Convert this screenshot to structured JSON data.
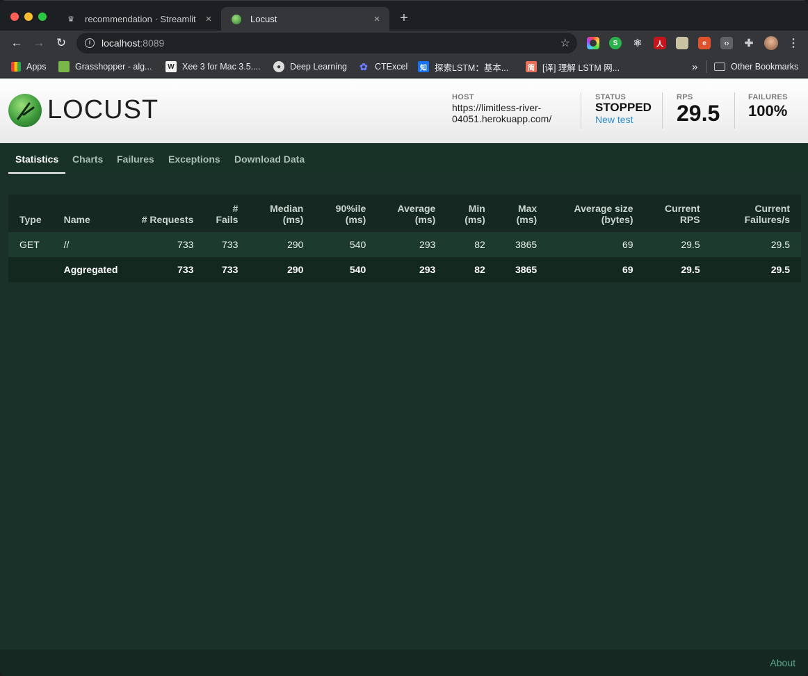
{
  "browser": {
    "tabs": [
      {
        "title": "recommendation · Streamlit",
        "favicon": "crown-icon"
      },
      {
        "title": "Locust",
        "favicon": "locust-icon"
      }
    ],
    "url_host": "localhost",
    "url_port": ":8089",
    "bookmarks": [
      {
        "label": "Apps",
        "icon": "apps-grid-icon"
      },
      {
        "label": "Grasshopper - alg...",
        "icon": "grasshopper-icon"
      },
      {
        "label": "Xee 3 for Mac 3.5....",
        "icon": "xee-icon"
      },
      {
        "label": "Deep Learning",
        "icon": "globe-icon"
      },
      {
        "label": "CTExcel",
        "icon": "ctexcel-icon"
      },
      {
        "label": "探索LSTM：基本...",
        "icon": "zhihu-icon"
      },
      {
        "label": "[译] 理解 LSTM 网...",
        "icon": "jianshu-icon"
      }
    ],
    "bookmarks_overflow": "»",
    "other_bookmarks": "Other Bookmarks"
  },
  "header": {
    "logo_text": "LOCUST",
    "host_label": "HOST",
    "host_value": "https://limitless-river-04051.herokuapp.com/",
    "status_label": "STATUS",
    "status_value": "STOPPED",
    "new_test": "New test",
    "rps_label": "RPS",
    "rps_value": "29.5",
    "failures_label": "FAILURES",
    "failures_value": "100%"
  },
  "nav": {
    "tabs": [
      "Statistics",
      "Charts",
      "Failures",
      "Exceptions",
      "Download Data"
    ],
    "active": "Statistics"
  },
  "table": {
    "headers": [
      [
        "Type"
      ],
      [
        "Name"
      ],
      [
        "# Requests"
      ],
      [
        "# Fails"
      ],
      [
        "Median",
        "(ms)"
      ],
      [
        "90%ile",
        "(ms)"
      ],
      [
        "Average",
        "(ms)"
      ],
      [
        "Min",
        "(ms)"
      ],
      [
        "Max",
        "(ms)"
      ],
      [
        "Average size",
        "(bytes)"
      ],
      [
        "Current",
        "RPS"
      ],
      [
        "Current",
        "Failures/s"
      ]
    ],
    "rows": [
      {
        "type": "GET",
        "name": "//",
        "requests": "733",
        "fails": "733",
        "median": "290",
        "p90": "540",
        "average": "293",
        "min": "82",
        "max": "3865",
        "avg_size": "69",
        "rps": "29.5",
        "failures_s": "29.5"
      }
    ],
    "aggregated": {
      "type": "",
      "name": "Aggregated",
      "requests": "733",
      "fails": "733",
      "median": "290",
      "p90": "540",
      "average": "293",
      "min": "82",
      "max": "3865",
      "avg_size": "69",
      "rps": "29.5",
      "failures_s": "29.5"
    }
  },
  "footer": {
    "about": "About"
  }
}
